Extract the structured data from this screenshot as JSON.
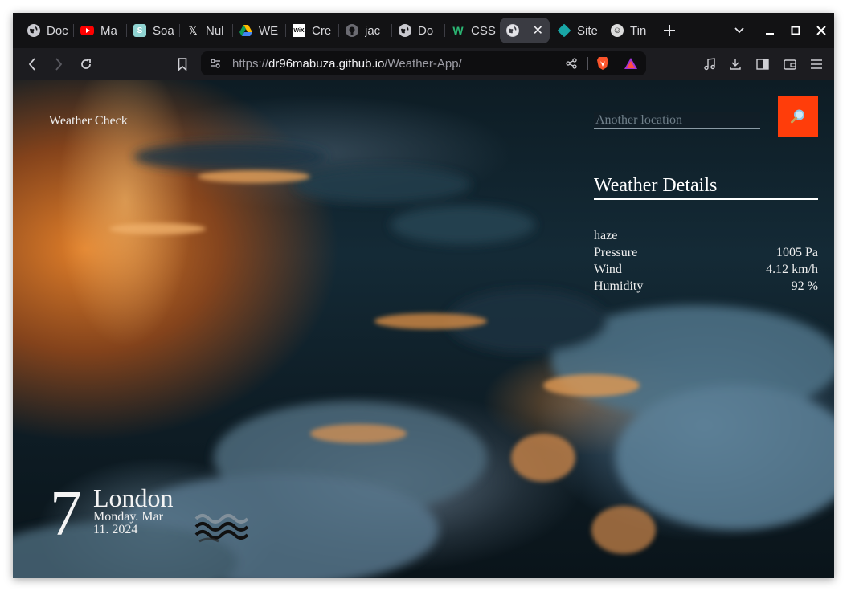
{
  "browser": {
    "tabs": [
      {
        "label": "Doc",
        "icon": "globe-icon"
      },
      {
        "label": "Ma",
        "icon": "youtube-icon"
      },
      {
        "label": "Soa",
        "icon": "s-icon"
      },
      {
        "label": "Nul",
        "icon": "x-logo-icon"
      },
      {
        "label": "WE",
        "icon": "google-drive-icon"
      },
      {
        "label": "Cre",
        "icon": "wix-icon"
      },
      {
        "label": "jac",
        "icon": "github-icon"
      },
      {
        "label": "Do",
        "icon": "globe-icon"
      },
      {
        "label": "CSS",
        "icon": "w-icon"
      },
      {
        "label": "",
        "icon": "globe-icon",
        "active": true
      },
      {
        "label": "Site",
        "icon": "diamond-icon"
      },
      {
        "label": "Tin",
        "icon": "tin-icon"
      }
    ],
    "url_scheme": "https://",
    "url_host": "dr96mabuza.github.io",
    "url_path": "/Weather-App/"
  },
  "weather_page": {
    "brand": "Weather Check",
    "search_placeholder": "Another location",
    "search_value": "",
    "search_button_icon": "magnifier-icon",
    "details_title": "Weather Details",
    "condition": "haze",
    "details": [
      {
        "label": "Pressure",
        "value": "1005 Pa"
      },
      {
        "label": "Wind",
        "value": "4.12 km/h"
      },
      {
        "label": "Humidity",
        "value": "92 %"
      }
    ],
    "temperature": "7",
    "city": "London",
    "date": "Monday. Mar 11. 2024",
    "condition_icon": "haze-icon"
  },
  "colors": {
    "search_button": "#ff3d0a",
    "tab_bar": "#121214",
    "toolbar": "#1c1c20"
  }
}
